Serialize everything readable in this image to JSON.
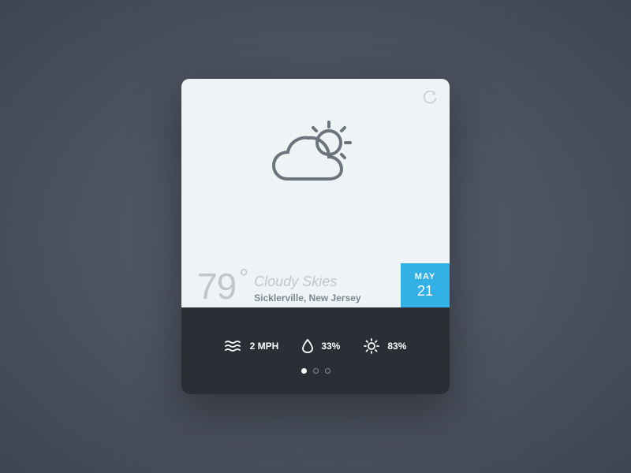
{
  "temperature": "79",
  "degree": "°",
  "condition": "Cloudy Skies",
  "location": "Sicklerville, New Jersey",
  "date": {
    "month": "MAY",
    "day": "21"
  },
  "stats": {
    "wind": "2 MPH",
    "humidity": "33%",
    "uv": "83%"
  },
  "pagination": {
    "total": 3,
    "active": 0
  },
  "colors": {
    "cardBg": "#eef3f5",
    "darkBg": "#2a2e35",
    "accent": "#33b1e6",
    "muted": "#c0c7ca"
  }
}
